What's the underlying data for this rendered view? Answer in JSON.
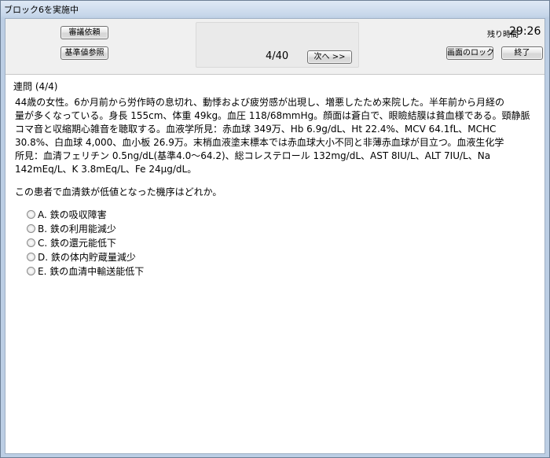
{
  "window": {
    "title": "ブロック6を実施中"
  },
  "toolbar": {
    "consult_label": "審議依頼",
    "reference_label": "基準値参照",
    "page_indicator": "4/40",
    "next_label": "次へ >>",
    "timer_label": "残り時間",
    "timer_value": "29:26",
    "lock_label": "画面のロック",
    "end_label": "終了"
  },
  "question": {
    "header": "連問 (4/4)",
    "stem": [
      "44歳の女性。6か月前から労作時の息切れ、動悸および疲労感が出現し、増悪したため来院した。半年前から月経の",
      "量が多くなっている。身長 155cm、体重 49kg。血圧 118/68mmHg。顔面は蒼白で、眼瞼結膜は貧血様である。頸静脈",
      "コマ音と収縮期心雑音を聴取する。血液学所見：赤血球 349万、Hb 6.9g/dL、Ht 22.4%、MCV 64.1fL、MCHC",
      "30.8%、白血球 4,000、血小板 26.9万。末梢血液塗末標本では赤血球大小不同と非薄赤血球が目立つ。血液生化学",
      "所見：血清フェリチン 0.5ng/dL(基準4.0～64.2)、総コレステロール 132mg/dL、AST 8IU/L、ALT 7IU/L、Na",
      "142mEq/L、K 3.8mEq/L、Fe 24μg/dL。"
    ],
    "prompt": "この患者で血清鉄が低値となった機序はどれか。",
    "options": [
      "A. 鉄の吸収障害",
      "B. 鉄の利用能減少",
      "C. 鉄の還元能低下",
      "D. 鉄の体内貯蔵量減少",
      "E. 鉄の血清中輸送能低下"
    ]
  }
}
